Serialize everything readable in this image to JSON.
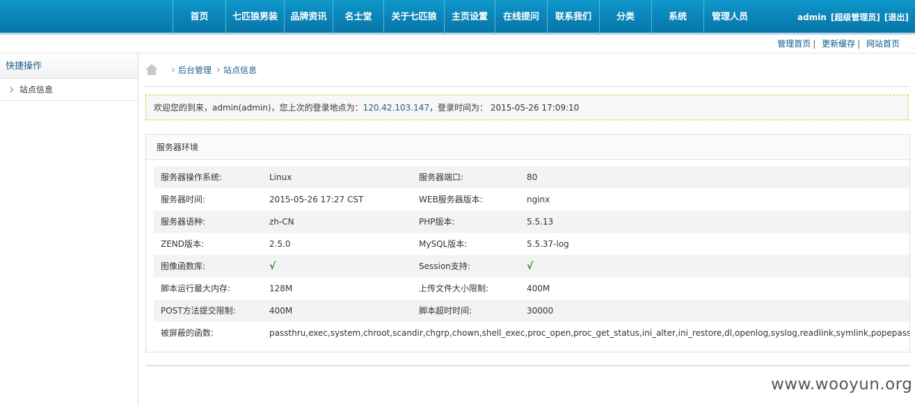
{
  "topnav": {
    "items": [
      "首页",
      "七匹狼男装",
      "品牌资讯",
      "名士堂",
      "关于七匹狼",
      "主页设置",
      "在线提问",
      "联系我们",
      "分类",
      "系统",
      "管理人员"
    ],
    "user": "admin",
    "role": "[超级管理员]",
    "logout": "[退出]"
  },
  "sublinks": {
    "home": "管理首页",
    "cache": "更新缓存",
    "site": "网站首页",
    "sep": "|"
  },
  "sidebar": {
    "title": "快捷操作",
    "items": [
      "站点信息"
    ]
  },
  "breadcrumb": {
    "level1": "后台管理",
    "level2": "站点信息"
  },
  "welcome": {
    "prefix": "欢迎您的到来，admin(admin)，您上次的登录地点为：",
    "ip": "120.42.103.147",
    "suffix": "，登录时间为：  2015-05-26 17:09:10"
  },
  "panel": {
    "title": "服务器环境",
    "rows": [
      [
        "服务器操作系统:",
        "Linux",
        "服务器端口:",
        "80"
      ],
      [
        "服务器时间:",
        "2015-05-26 17:27 CST",
        "WEB服务器版本:",
        "nginx"
      ],
      [
        "服务器语种:",
        "zh-CN",
        "PHP版本:",
        "5.5.13"
      ],
      [
        "ZEND版本:",
        "2.5.0",
        "MySQL版本:",
        "5.5.37-log"
      ],
      [
        "图像函数库:",
        "√",
        "Session支持:",
        "√"
      ],
      [
        "脚本运行最大内存:",
        "128M",
        "上传文件大小限制:",
        "400M"
      ],
      [
        "POST方法提交限制:",
        "400M",
        "脚本超时时间:",
        "30000"
      ],
      [
        "被屏蔽的函数:",
        "passthru,exec,system,chroot,scandir,chgrp,chown,shell_exec,proc_open,proc_get_status,ini_alter,ini_restore,dl,openlog,syslog,readlink,symlink,popepassthru"
      ]
    ]
  },
  "watermark": "www.wooyun.org",
  "colors": {
    "topbar": "#0a81b5",
    "link": "#1a5f8a",
    "check": "#1d8a1d",
    "welcome_border": "#e8c24c"
  }
}
